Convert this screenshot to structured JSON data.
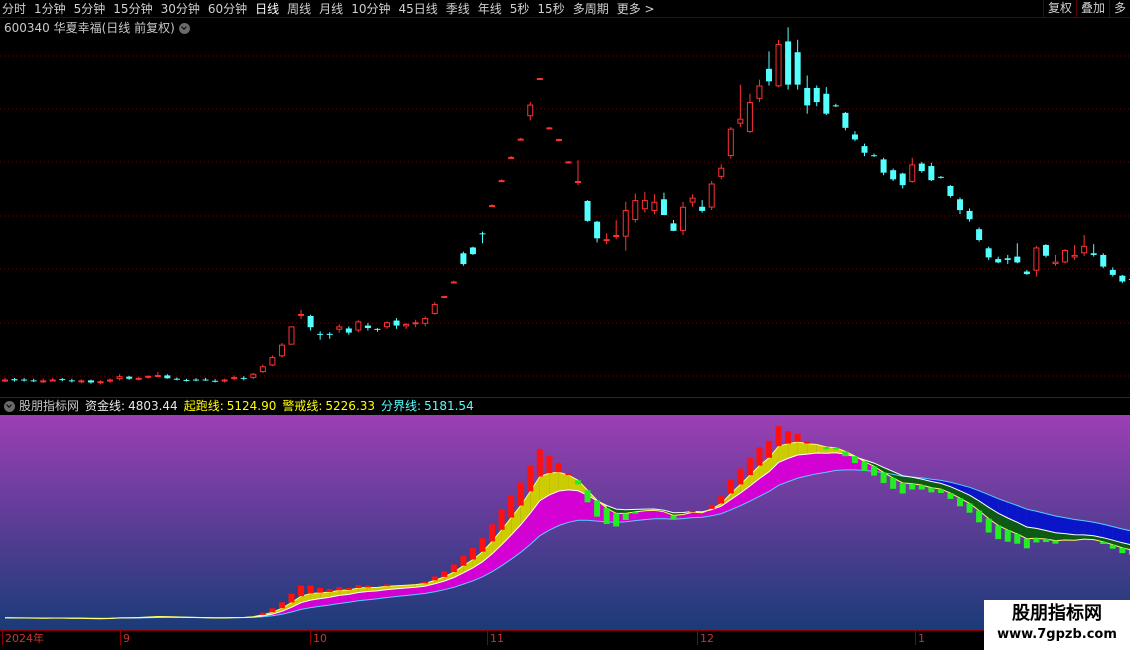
{
  "toolbar": {
    "periods": [
      "分时",
      "1分钟",
      "5分钟",
      "15分钟",
      "30分钟",
      "60分钟",
      "日线",
      "周线",
      "月线",
      "10分钟",
      "45日线",
      "季线",
      "年线",
      "5秒",
      "15秒",
      "多周期",
      "更多 >"
    ],
    "active_period": "日线",
    "right_tools": [
      "复权",
      "叠加",
      "多"
    ]
  },
  "main": {
    "stock_title": "600340 华夏幸福(日线 前复权)"
  },
  "indicator": {
    "name": "股朋指标网",
    "lines": [
      {
        "label": "资金线:",
        "value": "4803.44",
        "color": "#e8e8e8"
      },
      {
        "label": "起跑线:",
        "value": "5124.90",
        "color": "#ffff00"
      },
      {
        "label": "警戒线:",
        "value": "5226.33",
        "color": "#ffff00"
      },
      {
        "label": "分界线:",
        "value": "5181.54",
        "color": "#55ffff"
      }
    ]
  },
  "date_axis": {
    "labels": [
      "2024年",
      "9",
      "10",
      "11",
      "12",
      "1"
    ]
  },
  "watermark": {
    "title": "股朋指标网",
    "url": "www.7gpzb.com"
  },
  "colors": {
    "up": "#ff3232",
    "down": "#54ffff",
    "grid": "#7a0000",
    "bar_up": "#ff1010",
    "bar_down": "#22ee22"
  },
  "chart_data": {
    "type": "candlestick",
    "series": [
      {
        "name": "daily",
        "candles": [
          [
            1.6,
            1.66,
            1.56,
            1.62
          ],
          [
            1.63,
            1.66,
            1.57,
            1.6
          ],
          [
            1.62,
            1.66,
            1.57,
            1.61
          ],
          [
            1.6,
            1.64,
            1.56,
            1.59
          ],
          [
            1.58,
            1.64,
            1.54,
            1.6
          ],
          [
            1.61,
            1.66,
            1.58,
            1.62
          ],
          [
            1.63,
            1.66,
            1.58,
            1.61
          ],
          [
            1.6,
            1.64,
            1.55,
            1.58
          ],
          [
            1.58,
            1.63,
            1.53,
            1.6
          ],
          [
            1.6,
            1.62,
            1.52,
            1.55
          ],
          [
            1.54,
            1.6,
            1.5,
            1.58
          ],
          [
            1.58,
            1.65,
            1.54,
            1.62
          ],
          [
            1.63,
            1.75,
            1.6,
            1.7
          ],
          [
            1.69,
            1.71,
            1.61,
            1.64
          ],
          [
            1.64,
            1.69,
            1.6,
            1.66
          ],
          [
            1.68,
            1.72,
            1.64,
            1.71
          ],
          [
            1.72,
            1.8,
            1.7,
            1.73
          ],
          [
            1.72,
            1.75,
            1.64,
            1.65
          ],
          [
            1.64,
            1.67,
            1.6,
            1.62
          ],
          [
            1.61,
            1.64,
            1.57,
            1.6
          ],
          [
            1.62,
            1.65,
            1.58,
            1.61
          ],
          [
            1.62,
            1.66,
            1.59,
            1.6
          ],
          [
            1.59,
            1.63,
            1.55,
            1.57
          ],
          [
            1.58,
            1.64,
            1.55,
            1.62
          ],
          [
            1.63,
            1.72,
            1.6,
            1.68
          ],
          [
            1.66,
            1.7,
            1.6,
            1.64
          ],
          [
            1.66,
            1.78,
            1.63,
            1.76
          ],
          [
            1.8,
            1.98,
            1.78,
            1.94
          ],
          [
            1.96,
            2.2,
            1.94,
            2.16
          ],
          [
            2.18,
            2.5,
            2.15,
            2.46
          ],
          [
            2.46,
            2.9,
            2.46,
            2.9
          ],
          [
            3.2,
            3.3,
            3.08,
            3.2
          ],
          [
            3.15,
            3.18,
            2.8,
            2.88
          ],
          [
            2.72,
            2.78,
            2.58,
            2.7
          ],
          [
            2.72,
            2.76,
            2.6,
            2.7
          ],
          [
            2.82,
            2.95,
            2.75,
            2.9
          ],
          [
            2.85,
            2.9,
            2.7,
            2.75
          ],
          [
            2.8,
            3.05,
            2.76,
            3.02
          ],
          [
            2.92,
            2.98,
            2.8,
            2.86
          ],
          [
            2.84,
            2.86,
            2.77,
            2.82
          ],
          [
            2.88,
            3.02,
            2.84,
            3.0
          ],
          [
            3.04,
            3.1,
            2.84,
            2.92
          ],
          [
            2.9,
            2.98,
            2.84,
            2.96
          ],
          [
            2.98,
            3.06,
            2.88,
            3.0
          ],
          [
            2.96,
            3.14,
            2.9,
            3.1
          ],
          [
            3.2,
            3.48,
            3.18,
            3.44
          ],
          [
            3.62,
            3.64,
            3.62,
            3.63
          ],
          [
            3.96,
            4.0,
            3.96,
            3.98
          ],
          [
            4.66,
            4.7,
            4.36,
            4.4
          ],
          [
            4.8,
            4.82,
            4.62,
            4.64
          ],
          [
            5.14,
            5.18,
            4.9,
            5.12
          ],
          [
            5.8,
            5.84,
            5.8,
            5.82
          ],
          [
            6.4,
            6.44,
            6.4,
            6.42
          ],
          [
            6.97,
            7.0,
            6.97,
            6.98
          ],
          [
            7.4,
            7.44,
            7.4,
            7.42
          ],
          [
            7.96,
            8.3,
            7.86,
            8.24
          ],
          [
            8.86,
            8.88,
            8.86,
            8.88
          ],
          [
            7.68,
            7.7,
            7.68,
            7.69
          ],
          [
            7.4,
            7.42,
            7.4,
            7.41
          ],
          [
            6.86,
            6.88,
            6.86,
            6.87
          ],
          [
            6.4,
            6.9,
            6.3,
            6.4
          ],
          [
            5.92,
            5.94,
            5.42,
            5.44
          ],
          [
            5.42,
            5.44,
            4.92,
            5.02
          ],
          [
            4.98,
            5.14,
            4.88,
            5.0
          ],
          [
            5.06,
            5.46,
            5.0,
            5.1
          ],
          [
            5.06,
            5.9,
            4.72,
            5.7
          ],
          [
            5.46,
            6.1,
            5.4,
            5.94
          ],
          [
            5.72,
            6.14,
            5.64,
            5.94
          ],
          [
            5.68,
            6.08,
            5.6,
            5.9
          ],
          [
            5.96,
            6.12,
            5.58,
            5.58
          ],
          [
            5.38,
            5.46,
            5.2,
            5.2
          ],
          [
            5.2,
            5.9,
            5.1,
            5.78
          ],
          [
            5.88,
            6.08,
            5.78,
            6.0
          ],
          [
            5.78,
            5.94,
            5.64,
            5.68
          ],
          [
            5.76,
            6.4,
            5.7,
            6.34
          ],
          [
            6.5,
            6.8,
            6.44,
            6.72
          ],
          [
            7.0,
            7.7,
            6.94,
            7.66
          ],
          [
            7.78,
            8.72,
            7.7,
            7.9
          ],
          [
            7.58,
            8.5,
            7.56,
            8.3
          ],
          [
            8.38,
            8.84,
            8.3,
            8.7
          ],
          [
            9.1,
            9.52,
            8.7,
            8.8
          ],
          [
            8.68,
            9.8,
            8.66,
            9.7
          ],
          [
            9.76,
            10.1,
            8.6,
            8.72
          ],
          [
            9.5,
            9.8,
            8.6,
            8.72
          ],
          [
            8.64,
            8.94,
            8.02,
            8.22
          ],
          [
            8.64,
            8.7,
            8.2,
            8.3
          ],
          [
            8.5,
            8.66,
            7.99,
            8.02
          ],
          [
            8.22,
            8.26,
            8.18,
            8.2
          ],
          [
            8.04,
            8.06,
            7.62,
            7.68
          ],
          [
            7.52,
            7.6,
            7.36,
            7.4
          ],
          [
            7.24,
            7.3,
            7.0,
            7.08
          ],
          [
            7.02,
            7.06,
            6.98,
            7.0
          ],
          [
            6.92,
            6.96,
            6.54,
            6.6
          ],
          [
            6.66,
            6.7,
            6.4,
            6.44
          ],
          [
            6.58,
            6.6,
            6.22,
            6.3
          ],
          [
            6.38,
            6.96,
            6.36,
            6.8
          ],
          [
            6.82,
            6.86,
            6.6,
            6.64
          ],
          [
            6.76,
            6.84,
            6.4,
            6.42
          ],
          [
            6.5,
            6.52,
            6.46,
            6.48
          ],
          [
            6.28,
            6.3,
            6.0,
            6.04
          ],
          [
            5.96,
            6.0,
            5.6,
            5.7
          ],
          [
            5.68,
            5.74,
            5.42,
            5.48
          ],
          [
            5.24,
            5.28,
            4.94,
            4.98
          ],
          [
            4.78,
            4.82,
            4.5,
            4.56
          ],
          [
            4.52,
            4.58,
            4.42,
            4.44
          ],
          [
            4.54,
            4.62,
            4.4,
            4.5
          ],
          [
            4.58,
            4.9,
            4.42,
            4.44
          ],
          [
            4.22,
            4.26,
            4.14,
            4.16
          ],
          [
            4.24,
            4.84,
            4.1,
            4.8
          ],
          [
            4.86,
            4.88,
            4.56,
            4.6
          ],
          [
            4.4,
            4.62,
            4.36,
            4.46
          ],
          [
            4.44,
            4.76,
            4.42,
            4.74
          ],
          [
            4.56,
            4.86,
            4.5,
            4.62
          ],
          [
            4.66,
            5.1,
            4.6,
            4.84
          ],
          [
            4.66,
            4.88,
            4.58,
            4.62
          ],
          [
            4.62,
            4.66,
            4.3,
            4.34
          ],
          [
            4.26,
            4.32,
            4.1,
            4.14
          ],
          [
            4.12,
            4.14,
            3.94,
            3.98
          ],
          [
            4.04,
            4.08,
            4.0,
            4.02
          ],
          [
            4.08,
            4.12,
            3.88,
            3.9
          ],
          [
            4.0,
            4.36,
            3.96,
            4.3
          ],
          [
            4.48,
            4.72,
            4.3,
            4.68
          ]
        ]
      }
    ]
  }
}
